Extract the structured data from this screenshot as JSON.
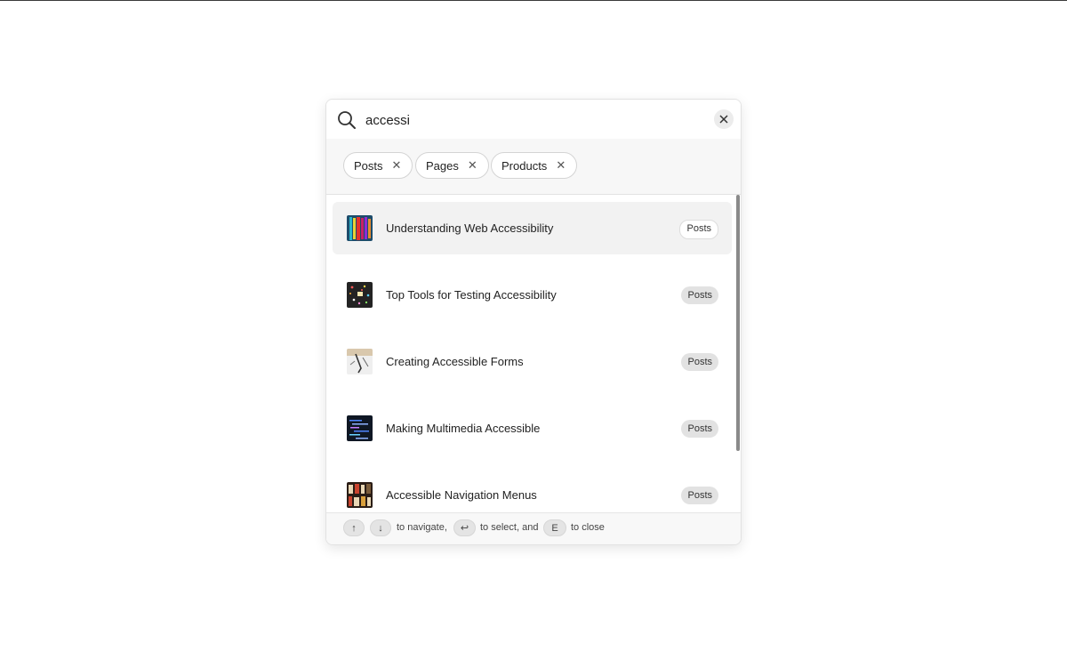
{
  "search": {
    "value": "accessi"
  },
  "filters": [
    {
      "label": "Posts",
      "remove": "✕"
    },
    {
      "label": "Pages",
      "remove": "✕"
    },
    {
      "label": "Products",
      "remove": "✕"
    }
  ],
  "results": [
    {
      "title": "Understanding Web Accessibility",
      "badge": "Posts",
      "thumb": "stripes-thumbnail"
    },
    {
      "title": "Top Tools for Testing Accessibility",
      "badge": "Posts",
      "thumb": "confetti-thumbnail"
    },
    {
      "title": "Creating Accessible Forms",
      "badge": "Posts",
      "thumb": "sketch-thumbnail"
    },
    {
      "title": "Making Multimedia Accessible",
      "badge": "Posts",
      "thumb": "code-screen-thumbnail"
    },
    {
      "title": "Accessible Navigation Menus",
      "badge": "Posts",
      "thumb": "bookshelf-thumbnail"
    }
  ],
  "footer": {
    "key_up": "↑",
    "key_down": "↓",
    "text_navigate": "to navigate,",
    "key_enter": "↩",
    "text_select": "to select, and",
    "key_close": "E",
    "text_close": "to close"
  }
}
